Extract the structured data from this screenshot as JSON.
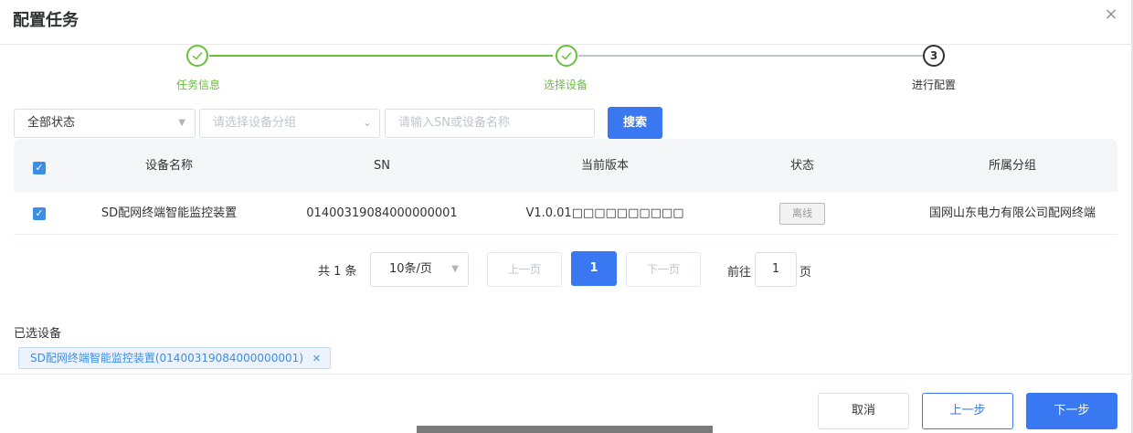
{
  "dialog": {
    "title": "配置任务",
    "close_icon": "close-icon"
  },
  "steps": [
    {
      "label": "任务信息",
      "status": "done"
    },
    {
      "label": "选择设备",
      "status": "done"
    },
    {
      "label": "进行配置",
      "status": "current",
      "number": "3"
    }
  ],
  "colors": {
    "primary": "#3a78f2",
    "success": "#67c23a",
    "tag_bg": "#ecf3fd"
  },
  "filters": {
    "status_value": "全部状态",
    "group_placeholder": "请选择设备分组",
    "keyword_placeholder": "请输入SN或设备名称",
    "search_label": "搜索"
  },
  "table": {
    "columns": [
      "设备名称",
      "SN",
      "当前版本",
      "状态",
      "所属分组"
    ],
    "header_checked": true,
    "rows": [
      {
        "checked": true,
        "name": "SD配网终端智能监控装置",
        "sn": "01400319084000000001",
        "version": "V1.0.01□□□□□□□□□□",
        "status": "离线",
        "group": "国网山东电力有限公司配网终端"
      }
    ]
  },
  "pagination": {
    "total_text": "共 1 条",
    "page_size": "10条/页",
    "prev_label": "上一页",
    "next_label": "下一页",
    "current_page": "1",
    "goto_prefix": "前往",
    "goto_value": "1",
    "goto_suffix": "页"
  },
  "selected": {
    "label": "已选设备",
    "tags": [
      "SD配网终端智能监控装置(01400319084000000001)"
    ]
  },
  "footer": {
    "cancel_label": "取消",
    "prev_label": "上一步",
    "next_label": "下一步"
  }
}
